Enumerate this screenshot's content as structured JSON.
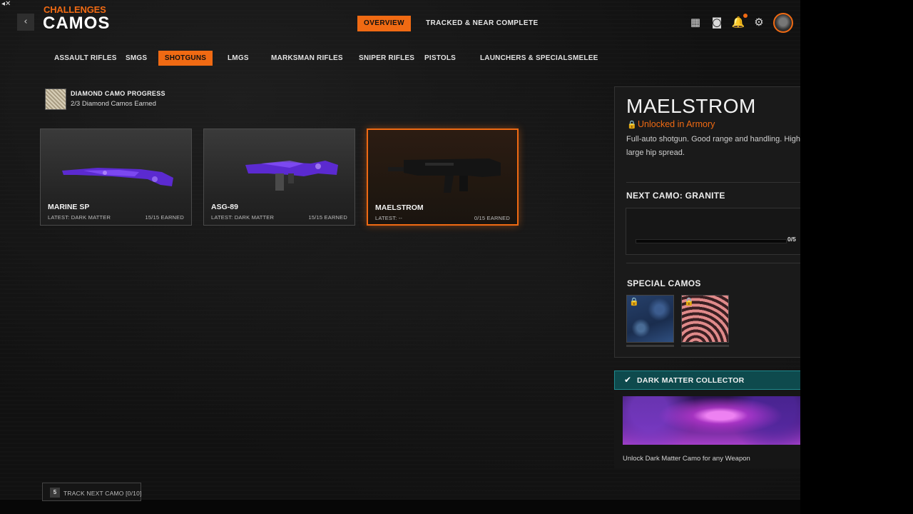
{
  "header": {
    "corner_icon": "◂✕",
    "section": "CHALLENGES",
    "title": "CAMOS",
    "back_icon": "‹"
  },
  "top_tabs": [
    {
      "label": "OVERVIEW",
      "active": true
    },
    {
      "label": "TRACKED & NEAR COMPLETE",
      "active": false
    }
  ],
  "top_icons": {
    "grid": "▦",
    "squad": "◙",
    "notifications": "🔔",
    "settings": "⚙"
  },
  "categories": [
    {
      "label": "ASSAULT RIFLES",
      "active": false
    },
    {
      "label": "SMGS",
      "active": false
    },
    {
      "label": "SHOTGUNS",
      "active": true
    },
    {
      "label": "LMGS",
      "active": false
    },
    {
      "label": "MARKSMAN RIFLES",
      "active": false
    },
    {
      "label": "SNIPER RIFLES",
      "active": false
    },
    {
      "label": "PISTOLS",
      "active": false
    },
    {
      "label": "LAUNCHERS & SPECIALS",
      "active": false
    },
    {
      "label": "MELEE",
      "active": false
    }
  ],
  "diamond": {
    "title": "DIAMOND CAMO PROGRESS",
    "subtitle": "2/3 Diamond Camos Earned"
  },
  "weapons": [
    {
      "name": "MARINE SP",
      "latest": "LATEST: DARK MATTER",
      "earned": "15/15 EARNED",
      "selected": false
    },
    {
      "name": "ASG-89",
      "latest": "LATEST: DARK MATTER",
      "earned": "15/15 EARNED",
      "selected": false
    },
    {
      "name": "MAELSTROM",
      "latest": "LATEST: --",
      "earned": "0/15 EARNED",
      "selected": true
    }
  ],
  "detail": {
    "name": "MAELSTROM",
    "lock_icon": "🔒",
    "unlock_text": "Unlocked in Armory",
    "description": "Full-auto shotgun.  Good range and handling. High large hip spread.",
    "next_camo_label": "NEXT CAMO: GRANITE",
    "progress_count": "0/5",
    "progress_fraction": 0,
    "special_title": "SPECIAL CAMOS"
  },
  "dark_matter": {
    "check_icon": "✔",
    "title": "DARK MATTER COLLECTOR",
    "description": "Unlock Dark Matter Camo for any Weapon"
  },
  "track": {
    "key": "5",
    "label": "TRACK NEXT CAMO [0/10]"
  },
  "colors": {
    "accent": "#f06a13",
    "teal": "#0e4a4d",
    "camo_purple": "#6a2fe0"
  }
}
